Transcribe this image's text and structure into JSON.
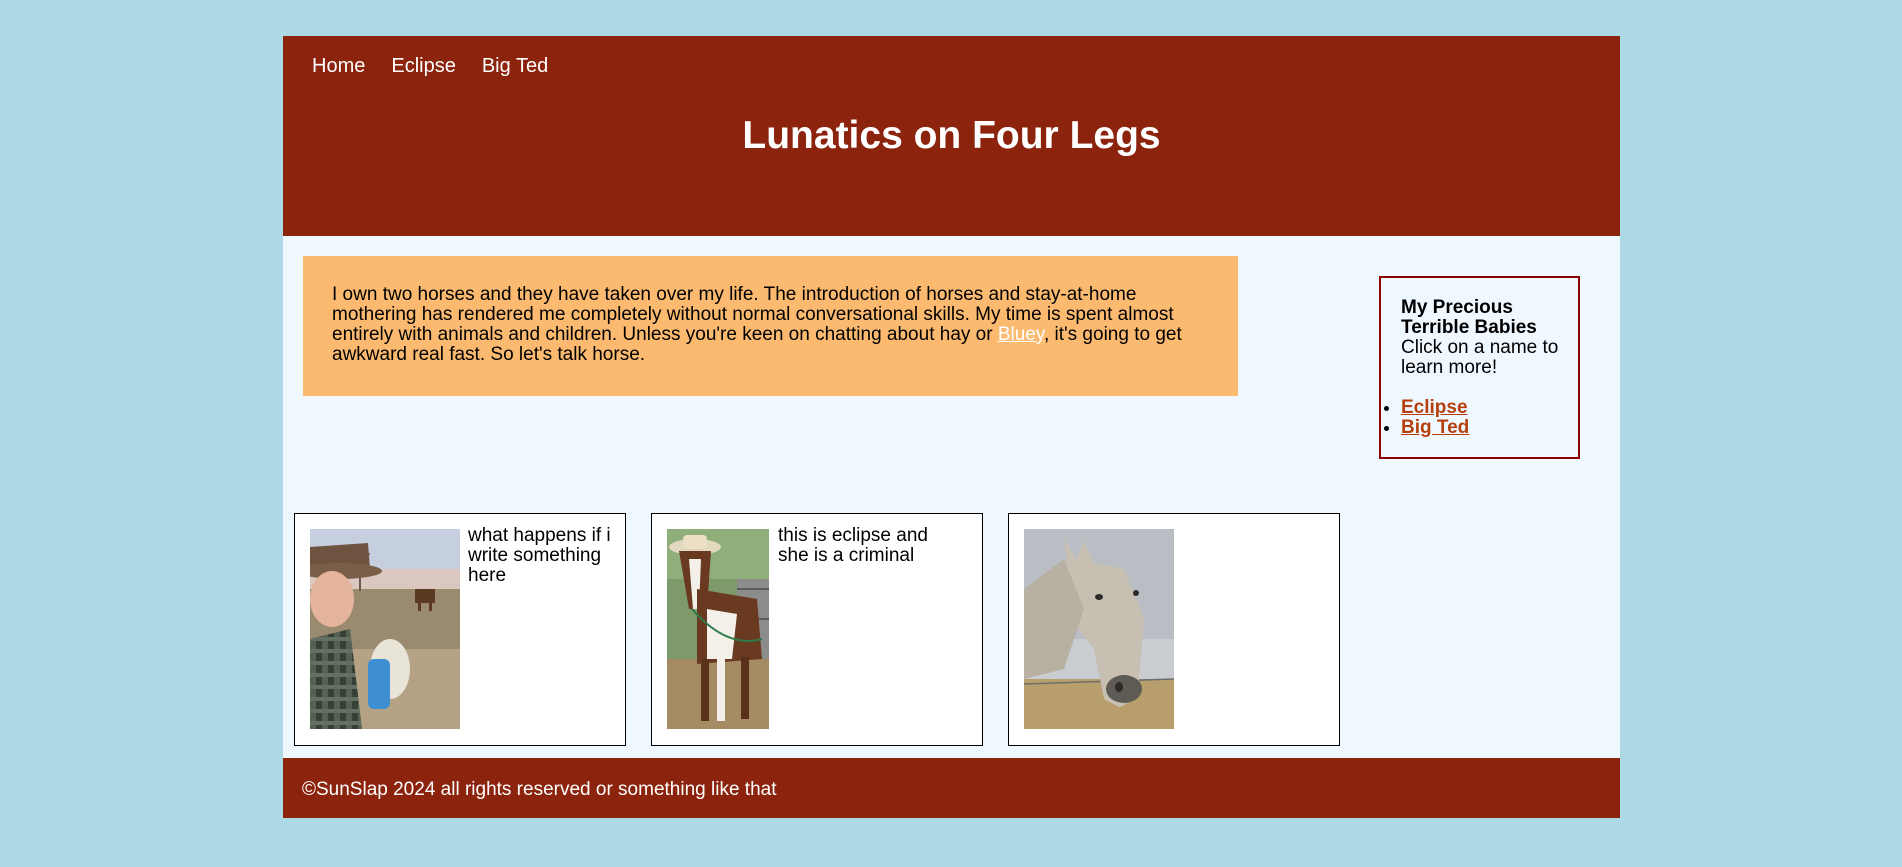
{
  "nav": {
    "items": [
      "Home",
      "Eclipse",
      "Big Ted"
    ]
  },
  "header": {
    "title": "Lunatics on Four Legs"
  },
  "intro": {
    "text_before_link": "I own two horses and they have taken over my life. The introduction of horses and stay-at-home mothering has rendered me completely without normal conversational skills. My time is spent almost entirely with animals and children. Unless you're keen on chatting about hay or ",
    "link_text": "Bluey",
    "text_after_link": ", it's going to get awkward real fast. So let's talk horse."
  },
  "sidebar": {
    "heading": "My Precious Terrible Babies",
    "text": "Click on a name to learn more!",
    "links": [
      "Eclipse",
      "Big Ted"
    ]
  },
  "cards": [
    {
      "caption": "what happens if i write something here",
      "photo": "woman-in-cowboy-hat-with-horse-photo"
    },
    {
      "caption": "this is eclipse and she is a criminal",
      "photo": "paint-horse-wearing-hat-photo"
    },
    {
      "caption": "",
      "photo": "grey-horse-closeup-photo"
    }
  ],
  "footer": {
    "text": "©SunSlap 2024 all rights reserved or something like that"
  },
  "colors": {
    "background": "#add8e6",
    "page": "#f0f8ff",
    "header_footer": "#8b230d",
    "intro_box": "#fbba6f",
    "sidebar_border": "#8b0000",
    "sidebar_links": "#b5400d"
  }
}
